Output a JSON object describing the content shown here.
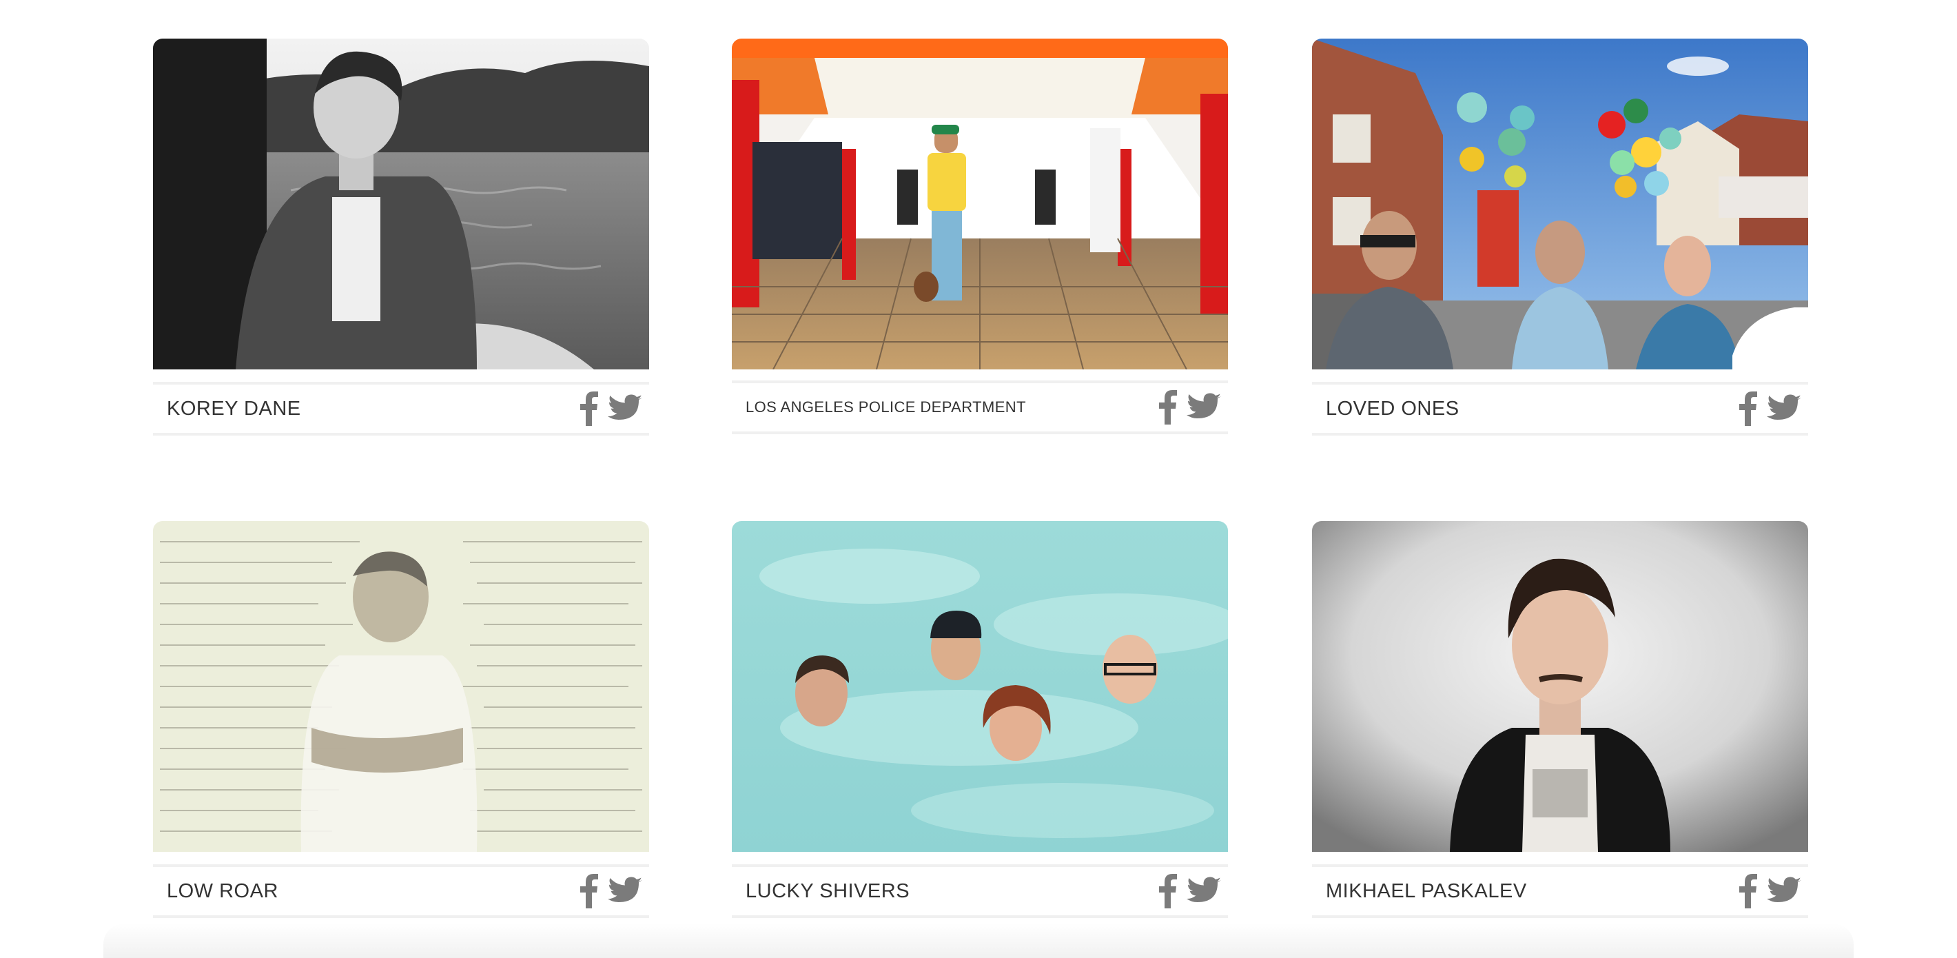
{
  "artists": [
    {
      "name": "KOREY DANE",
      "photo": "black-and-white photo of a man in a rowboat on a lake"
    },
    {
      "name": "LOS ANGELES POLICE DEPARTMENT",
      "photo": "man in yellow t-shirt standing in a tiled arcade corridor"
    },
    {
      "name": "LOVED ONES",
      "photo": "three men on a street with colorful balloons"
    },
    {
      "name": "LOW ROAR",
      "photo": "faded double exposure of a man over handwritten lyrics"
    },
    {
      "name": "LUCKY SHIVERS",
      "photo": "four faces floating in a light blue cloudy sky"
    },
    {
      "name": "MIKHAEL PASKALEV",
      "photo": "portrait of a man in a dark hoodie on a grey background"
    }
  ],
  "share_icons": [
    "facebook-icon",
    "twitter-icon"
  ],
  "colors": {
    "text": "#333333",
    "icon": "#7b7b7b",
    "divider": "#f0f0f0"
  }
}
